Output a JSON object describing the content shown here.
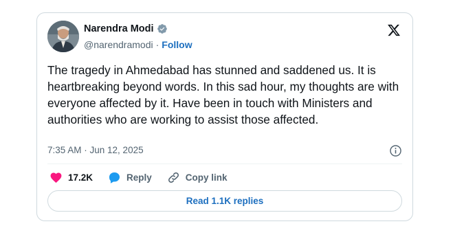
{
  "author": {
    "name": "Narendra Modi",
    "handle": "@narendramodi",
    "separator": "·",
    "follow_label": "Follow"
  },
  "tweet": {
    "text": "The tragedy in Ahmedabad has stunned and saddened us. It is heartbreaking beyond words. In this sad hour, my thoughts are with everyone affected by it. Have been in touch with Ministers and authorities who are working to assist those affected.",
    "timestamp": "7:35 AM · Jun 12, 2025"
  },
  "actions": {
    "likes": "17.2K",
    "reply_label": "Reply",
    "copy_link_label": "Copy link"
  },
  "replies_button": "Read 1.1K replies",
  "colors": {
    "link": "#1d6fbf",
    "like": "#f91880",
    "reply": "#1d9bf0",
    "verified": "#829aab",
    "text": "#0f1419",
    "muted": "#536471"
  },
  "icons": {
    "verified": "verified-badge-icon",
    "brand": "x-logo-icon",
    "info": "info-icon",
    "like": "heart-icon",
    "reply": "reply-bubble-icon",
    "copy": "link-icon"
  }
}
